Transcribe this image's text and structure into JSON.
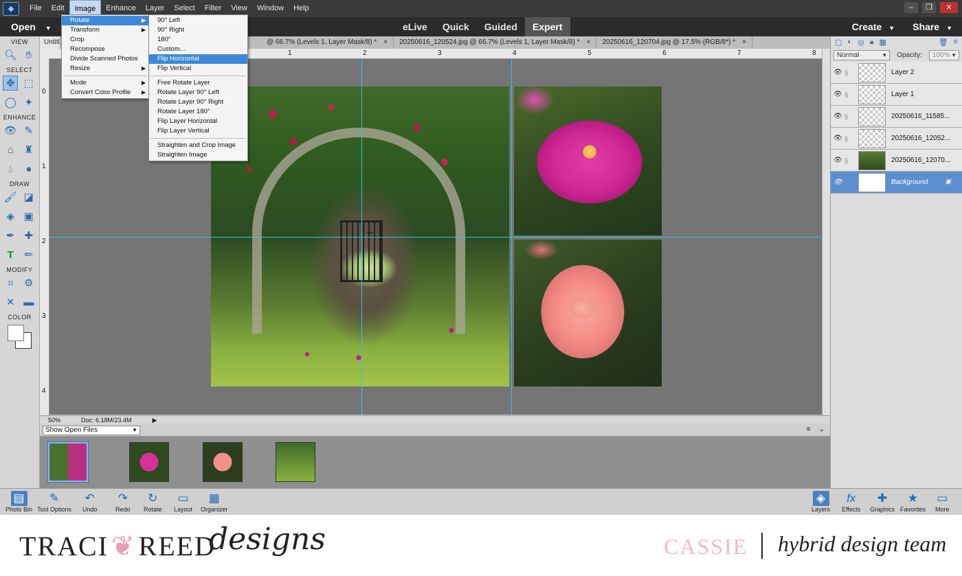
{
  "menubar": {
    "items": [
      "File",
      "Edit",
      "Image",
      "Enhance",
      "Layer",
      "Select",
      "Filter",
      "View",
      "Window",
      "Help"
    ],
    "active": "Image"
  },
  "modebar": {
    "open_label": "Open",
    "modes": [
      "eLive",
      "Quick",
      "Guided",
      "Expert"
    ],
    "active_mode": "Expert",
    "create_label": "Create",
    "share_label": "Share"
  },
  "toolbox": {
    "sections": {
      "view": "VIEW",
      "select": "SELECT",
      "enhance": "ENHANCE",
      "draw": "DRAW",
      "modify": "MODIFY",
      "color": "COLOR"
    }
  },
  "tabs": [
    {
      "label": "Untitl"
    },
    {
      "label": "@ 66.7% (Levels 1, Layer Mask/8) *"
    },
    {
      "label": "20250616_120524.jpg @ 66.7% (Levels 1, Layer Mask/8) *"
    },
    {
      "label": "20250616_120704.jpg @ 17.5% (RGB/8*) *"
    }
  ],
  "ruler": {
    "h_labels": [
      "0",
      "1",
      "2",
      "3",
      "4",
      "5",
      "6",
      "7",
      "8"
    ],
    "v_labels": [
      "0",
      "1",
      "2",
      "3",
      "4"
    ]
  },
  "status": {
    "zoom": "50%",
    "doc": "Doc: 6.18M/23.4M"
  },
  "photo_bin": {
    "show_label": "Show Open Files"
  },
  "image_menu": {
    "items": [
      "Rotate",
      "Transform",
      "Crop",
      "Recompose",
      "Divide Scanned Photos",
      "Resize",
      "Mode",
      "Convert Color Profile"
    ],
    "highlighted": "Rotate"
  },
  "rotate_submenu": {
    "group1": [
      "90° Left",
      "90° Right",
      "180°",
      "Custom...",
      "Flip Horizontal",
      "Flip Vertical"
    ],
    "group2": [
      "Free Rotate Layer",
      "Rotate Layer 90° Left",
      "Rotate Layer 90° Right",
      "Rotate Layer 180°",
      "Flip Layer Horizontal",
      "Flip Layer Vertical"
    ],
    "group3": [
      "Straighten and Crop Image",
      "Straighten Image"
    ],
    "highlighted": "Flip Horizontal"
  },
  "layers_panel": {
    "blend_mode": "Normal",
    "opacity_label": "Opacity:",
    "opacity_value": "100%",
    "layers": [
      {
        "name": "Layer 2"
      },
      {
        "name": "Layer 1"
      },
      {
        "name": "20250616_11585..."
      },
      {
        "name": "20250616_12052..."
      },
      {
        "name": "20250616_12070..."
      },
      {
        "name": "Background"
      }
    ],
    "selected": "Background"
  },
  "taskbar": {
    "left": [
      "Photo Bin",
      "Tool Options",
      "Undo",
      "Redo",
      "Rotate",
      "Layout",
      "Organizer"
    ],
    "right": [
      "Layers",
      "Effects",
      "Graphics",
      "Favorites",
      "More"
    ]
  },
  "branding": {
    "name": "TRACI",
    "name2": "REED",
    "script": "designs",
    "designer": "CASSIE",
    "team": "hybrid design team"
  },
  "colors": {
    "accent": "#3e8ad6",
    "guide": "#27c8e8",
    "selected_layer": "#5b8fd1",
    "cassie_pink": "#f0b8cc"
  }
}
